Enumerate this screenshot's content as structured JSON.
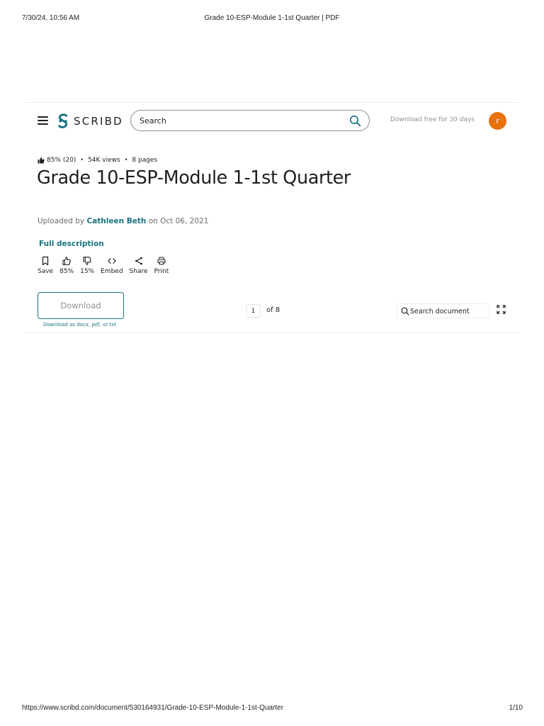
{
  "print_header": {
    "datetime": "7/30/24, 10:56 AM",
    "page_title": "Grade 10-ESP-Module 1-1st Quarter | PDF"
  },
  "print_footer": {
    "url": "https://www.scribd.com/document/530164931/Grade-10-ESP-Module-1-1st-Quarter",
    "page_number": "1/10"
  },
  "header": {
    "logo_text": "SCRIBD",
    "search_placeholder": "Search",
    "trial_link": "Download free for 30 days",
    "avatar_initial": "r"
  },
  "stats": {
    "rating": "85% (20)",
    "views": "54K views",
    "pages": "8 pages"
  },
  "document": {
    "title": "Grade 10-ESP-Module 1-1st Quarter",
    "uploaded_prefix": "Uploaded by",
    "author": "Cathleen Beth",
    "uploaded_suffix": "on Oct 06, 2021",
    "full_description": "Full description"
  },
  "actions": {
    "save": "Save",
    "like": "85%",
    "dislike": "15%",
    "embed": "Embed",
    "share": "Share",
    "print": "Print"
  },
  "download": {
    "label": "Download",
    "sub": "Download as docx, pdf, or txt"
  },
  "pager": {
    "current_page": "1",
    "of_text": "of 8"
  },
  "doc_search": {
    "placeholder": "Search document"
  },
  "colors": {
    "brand_teal": "#1a7480",
    "avatar": "#e8720c"
  }
}
